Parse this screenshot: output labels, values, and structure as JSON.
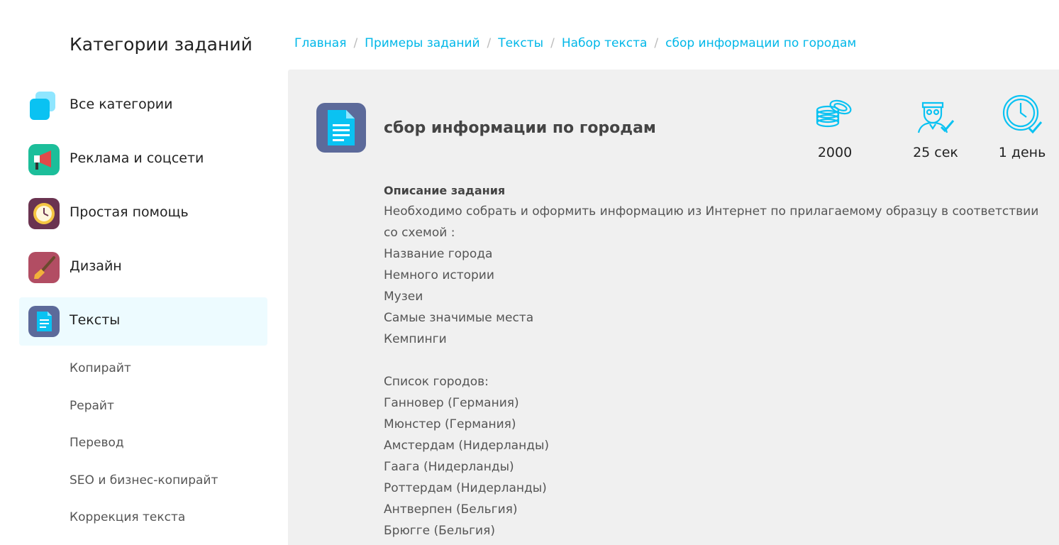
{
  "sidebar": {
    "title": "Категории заданий",
    "categories": [
      {
        "label": "Все категории"
      },
      {
        "label": "Реклама и соцсети"
      },
      {
        "label": "Простая помощь"
      },
      {
        "label": "Дизайн"
      },
      {
        "label": "Тексты"
      }
    ],
    "subcategories": [
      {
        "label": "Копирайт"
      },
      {
        "label": "Рерайт"
      },
      {
        "label": "Перевод"
      },
      {
        "label": "SEO и бизнес-копирайт"
      },
      {
        "label": "Коррекция текста"
      }
    ]
  },
  "breadcrumb": [
    "Главная",
    "Примеры заданий",
    "Тексты",
    "Набор текста",
    "сбор информации по городам"
  ],
  "task": {
    "title": "сбор информации по городам",
    "stats": {
      "price": "2000",
      "time": "25 сек",
      "deadline": "1 день"
    },
    "description_heading": "Описание задания",
    "description_intro": "Необходимо собрать и оформить информацию из Интернет по прилагаемому образцу в соответствии со схемой :",
    "scheme": [
      "Название города",
      "Немного истории",
      "Музеи",
      "Самые значимые места",
      "Кемпинги"
    ],
    "cities_heading": "Список городов:",
    "cities": [
      "Ганновер (Германия)",
      "Мюнстер (Германия)",
      "Амстердам (Нидерланды)",
      "Гаага (Нидерланды)",
      "Роттердам (Нидерланды)",
      "Антверпен (Бельгия)",
      "Брюгге (Бельгия)"
    ]
  },
  "colors": {
    "accent": "#00b7e8",
    "active_bg": "#edfbff",
    "panel_bg": "#f0f0f0"
  }
}
